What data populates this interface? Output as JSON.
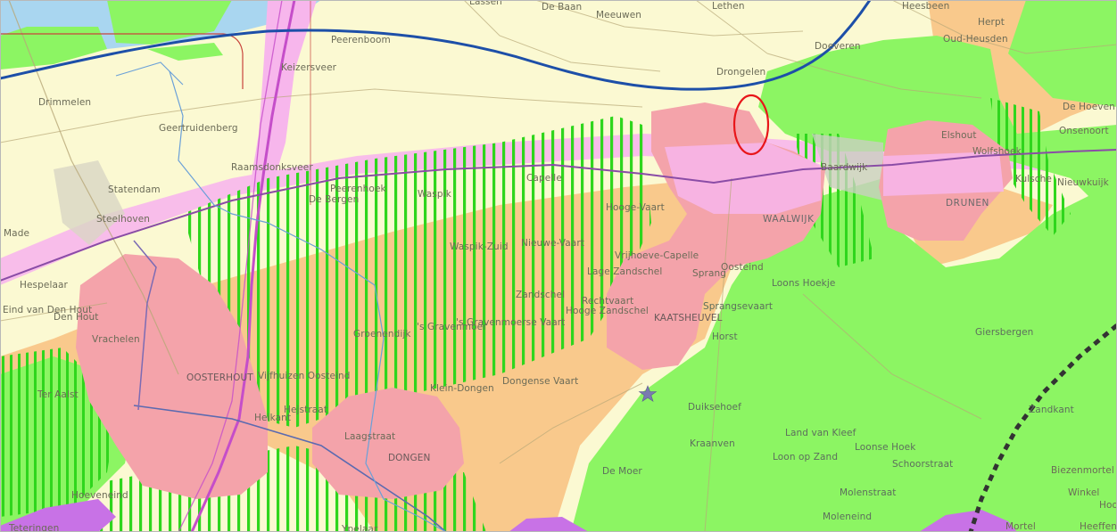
{
  "map": {
    "colors": {
      "land": "#fbf9d2",
      "water": "#a9d6f0",
      "green": "#8cf563",
      "pink": "#f4a3aa",
      "magenta": "#f7b6ec",
      "orange": "#f9c98c",
      "hatch": "#2fd61d",
      "purple": "#c872e6",
      "river_line": "#1d4fa8",
      "marker": "#e8161a"
    },
    "labels": [
      {
        "text": "Lassen"
      },
      {
        "text": "De Baan"
      },
      {
        "text": "Meeuwen"
      },
      {
        "text": "Lethen"
      },
      {
        "text": "Heesbeen"
      },
      {
        "text": "Herpt"
      },
      {
        "text": "Oud-Heusden"
      },
      {
        "text": "Peerenboom"
      },
      {
        "text": "Keizersveer"
      },
      {
        "text": "Doeveren"
      },
      {
        "text": "Drongelen"
      },
      {
        "text": "Drimmelen"
      },
      {
        "text": "Geertruidenberg"
      },
      {
        "text": "De Hoeven"
      },
      {
        "text": "Elshout"
      },
      {
        "text": "Onsenoort"
      },
      {
        "text": "Raamsdonksveer"
      },
      {
        "text": "Wolfshoek"
      },
      {
        "text": "Baardwijk"
      },
      {
        "text": "Kulsche"
      },
      {
        "text": "Nieuwkuijk"
      },
      {
        "text": "Statendam"
      },
      {
        "text": "Peerenhoek"
      },
      {
        "text": "De Bergen"
      },
      {
        "text": "Waspik"
      },
      {
        "text": "Capelle"
      },
      {
        "text": "Hooge-Vaart"
      },
      {
        "text": "WAALWIJK"
      },
      {
        "text": "DRUNEN"
      },
      {
        "text": "Steelhoven"
      },
      {
        "text": "Made"
      },
      {
        "text": "Waspik-Zuid"
      },
      {
        "text": "Nieuwe-Vaart"
      },
      {
        "text": "Vrijhoeve-Capelle"
      },
      {
        "text": "Lage Zandschel"
      },
      {
        "text": "Sprang"
      },
      {
        "text": "Oosteind"
      },
      {
        "text": "Loons Hoekje"
      },
      {
        "text": "Hespelaar"
      },
      {
        "text": "Eind van Den Hout"
      },
      {
        "text": "Den Hout"
      },
      {
        "text": "Zandschel"
      },
      {
        "text": "Rechtvaart"
      },
      {
        "text": "Hooge Zandschel"
      },
      {
        "text": "Sprangsevaart"
      },
      {
        "text": "Groenendijk"
      },
      {
        "text": "'s Gravenmoer"
      },
      {
        "text": "'s Gravenmoerse Vaart"
      },
      {
        "text": "KAATSHEUVEL"
      },
      {
        "text": "Horst"
      },
      {
        "text": "Giersbergen"
      },
      {
        "text": "Vrachelen"
      },
      {
        "text": "OOSTERHOUT"
      },
      {
        "text": "Vijfhuizen Oosteind"
      },
      {
        "text": "Klein-Dongen"
      },
      {
        "text": "Dongense Vaart"
      },
      {
        "text": "Ter Aalst"
      },
      {
        "text": "Heikant"
      },
      {
        "text": "Hejstraat"
      },
      {
        "text": "Duiksehoef"
      },
      {
        "text": "Zandkant"
      },
      {
        "text": "Laagstraat"
      },
      {
        "text": "Land van Kleef"
      },
      {
        "text": "Kraanven"
      },
      {
        "text": "Loonse Hoek"
      },
      {
        "text": "Loon op Zand"
      },
      {
        "text": "Schoorstraat"
      },
      {
        "text": "DONGEN"
      },
      {
        "text": "De Moer"
      },
      {
        "text": "Biezenmortel"
      },
      {
        "text": "Hoeveneind"
      },
      {
        "text": "Molenstraat"
      },
      {
        "text": "Winkel"
      },
      {
        "text": "Hoo"
      },
      {
        "text": "Moleneind"
      },
      {
        "text": "Mortel"
      },
      {
        "text": "Teteringen"
      },
      {
        "text": "Ypelaar"
      },
      {
        "text": "Heeffen"
      }
    ]
  }
}
